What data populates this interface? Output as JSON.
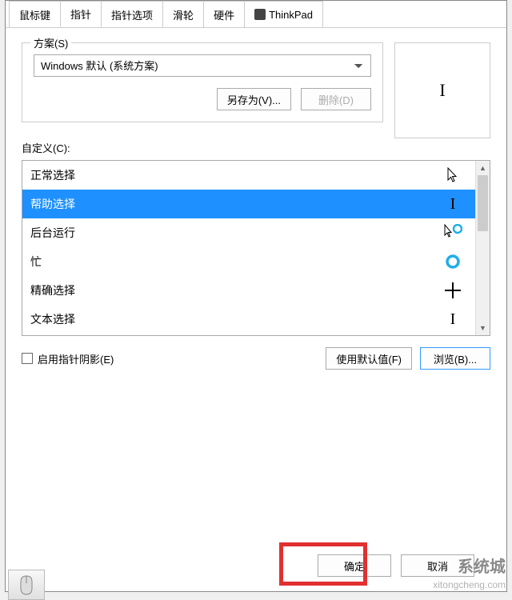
{
  "tabs": {
    "mouse_keys": "鼠标键",
    "pointer": "指针",
    "pointer_options": "指针选项",
    "wheel": "滑轮",
    "hardware": "硬件",
    "thinkpad": "ThinkPad"
  },
  "scheme": {
    "label": "方案(S)",
    "selected": "Windows 默认 (系统方案)",
    "save_as": "另存为(V)...",
    "delete": "删除(D)"
  },
  "customize": {
    "label": "自定义(C):"
  },
  "cursor_items": {
    "normal": "正常选择",
    "help": "帮助选择",
    "background": "后台运行",
    "busy": "忙",
    "precision": "精确选择",
    "text": "文本选择"
  },
  "shadow_checkbox": "启用指针阴影(E)",
  "buttons": {
    "use_default": "使用默认值(F)",
    "browse": "浏览(B)...",
    "ok": "确定",
    "cancel": "取消"
  },
  "watermark": {
    "brand": "系统城",
    "url": "xitongcheng.com"
  }
}
